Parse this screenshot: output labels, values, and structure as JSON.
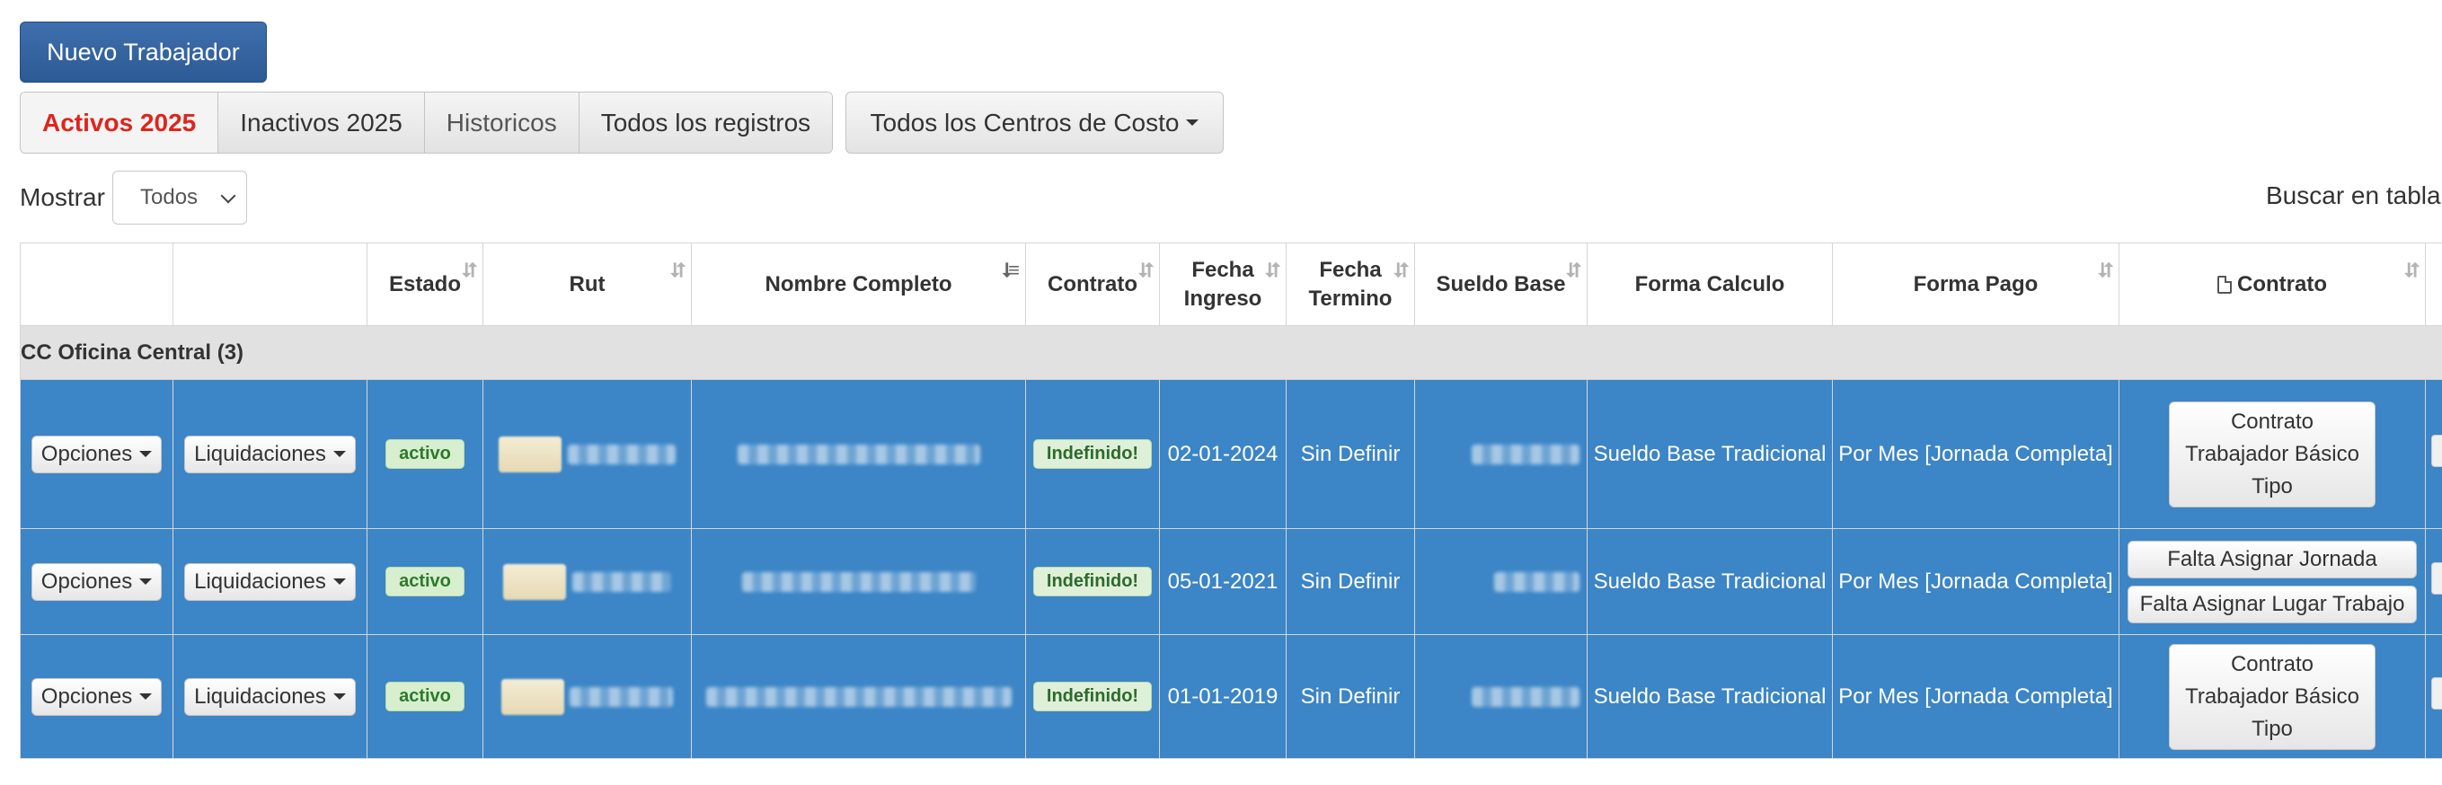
{
  "toolbar": {
    "new_worker_label": "Nuevo Trabajador",
    "filters": [
      "Activos 2025",
      "Inactivos 2025",
      "Historicos",
      "Todos los registros"
    ],
    "cost_centers_label": "Todos los Centros de Costo"
  },
  "controls": {
    "show_label": "Mostrar",
    "show_value": "Todos",
    "search_label": "Buscar en tabla"
  },
  "table": {
    "headers": {
      "estado": "Estado",
      "rut": "Rut",
      "nombre": "Nombre Completo",
      "contrato": "Contrato",
      "fecha_ingreso_1": "Fecha",
      "fecha_ingreso_2": "Ingreso",
      "fecha_termino_1": "Fecha",
      "fecha_termino_2": "Termino",
      "sueldo_base": "Sueldo Base",
      "forma_calculo": "Forma Calculo",
      "forma_pago": "Forma Pago",
      "contrato_doc": "Contrato"
    },
    "group_label": "CC Oficina Central (3)",
    "row_options_label": "Opciones",
    "row_liquidaciones_label": "Liquidaciones",
    "rows": [
      {
        "estado": "activo",
        "contrato": "Indefinido!",
        "fecha_ingreso": "02-01-2024",
        "fecha_termino": "Sin Definir",
        "forma_calculo": "Sueldo Base Tradicional",
        "forma_pago": "Por Mes [Jornada Completa]",
        "contract_actions": [
          "Contrato Trabajador Básico Tipo"
        ]
      },
      {
        "estado": "activo",
        "contrato": "Indefinido!",
        "fecha_ingreso": "05-01-2021",
        "fecha_termino": "Sin Definir",
        "forma_calculo": "Sueldo Base Tradicional",
        "forma_pago": "Por Mes [Jornada Completa]",
        "contract_actions": [
          "Falta Asignar Jornada",
          "Falta Asignar Lugar Trabajo"
        ]
      },
      {
        "estado": "activo",
        "contrato": "Indefinido!",
        "fecha_ingreso": "01-01-2019",
        "fecha_termino": "Sin Definir",
        "forma_calculo": "Sueldo Base Tradicional",
        "forma_pago": "Por Mes [Jornada Completa]",
        "contract_actions": [
          "Contrato Trabajador Básico Tipo"
        ]
      }
    ]
  },
  "colors": {
    "primary_button": "#2c5a94",
    "active_filter_text": "#e0241b",
    "selected_row": "#3c85c6",
    "group_row": "#e1e1e1",
    "status_badge": "#d8efcf"
  },
  "icons": {
    "sort": "sort-arrows-icon",
    "dropdown": "caret-down-icon",
    "contract_doc": "pdf-file-icon"
  }
}
